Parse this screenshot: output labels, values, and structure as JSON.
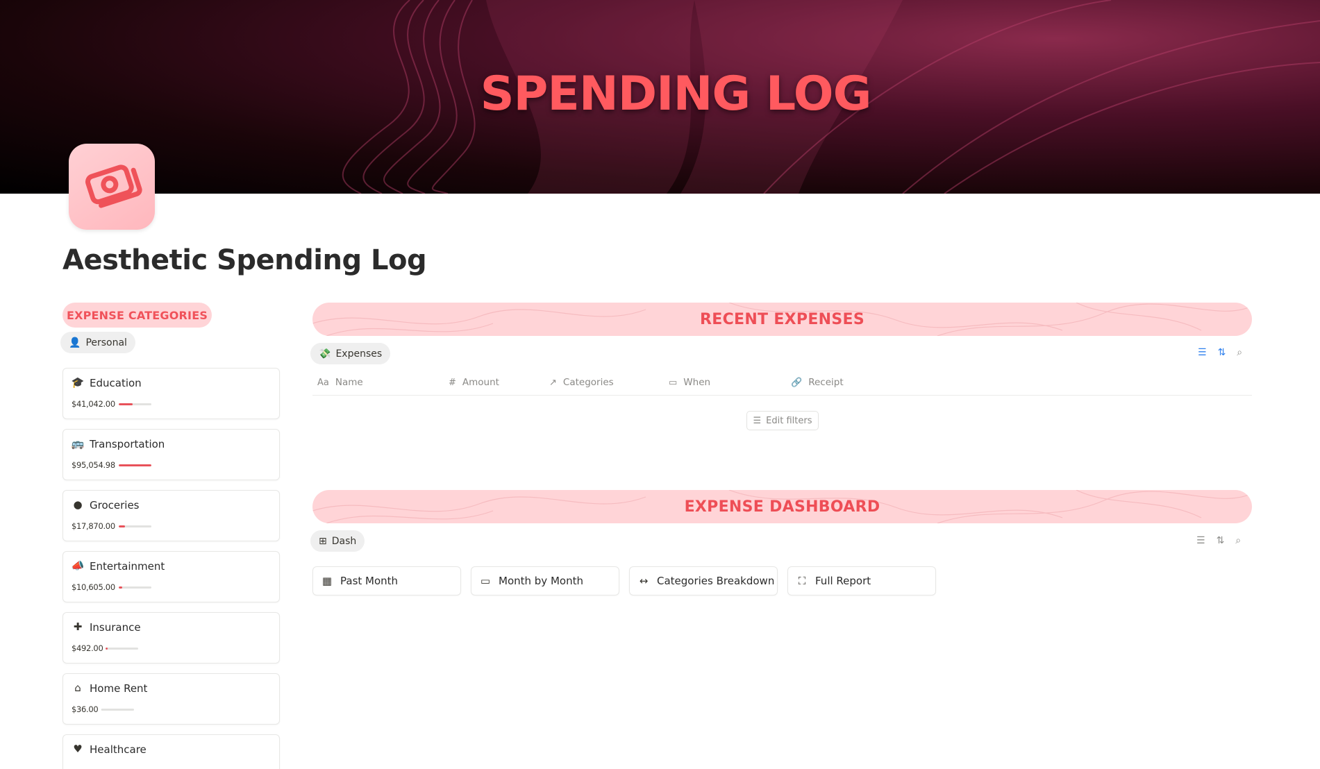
{
  "banner": {
    "title": "SPENDING LOG"
  },
  "page": {
    "title": "Aesthetic Spending Log"
  },
  "categories": {
    "header": "EXPENSE CATEGORIES",
    "view_label": "Personal",
    "items": [
      {
        "name": "Education",
        "amount": "$41,042.00",
        "icon": "graduation-cap-icon",
        "glyph": "🎓",
        "progress": 0.43
      },
      {
        "name": "Transportation",
        "amount": "$95,054.98",
        "icon": "bus-icon",
        "glyph": "🚌",
        "progress": 1.0
      },
      {
        "name": "Groceries",
        "amount": "$17,870.00",
        "icon": "apple-icon",
        "glyph": "●",
        "progress": 0.19
      },
      {
        "name": "Entertainment",
        "amount": "$10,605.00",
        "icon": "megaphone-icon",
        "glyph": "📣",
        "progress": 0.11
      },
      {
        "name": "Insurance",
        "amount": "$492.00",
        "icon": "plus-icon",
        "glyph": "✚",
        "progress": 0.01
      },
      {
        "name": "Home Rent",
        "amount": "$36.00",
        "icon": "house-icon",
        "glyph": "⌂",
        "progress": 0.0
      },
      {
        "name": "Healthcare",
        "amount": "",
        "icon": "heart-pulse-icon",
        "glyph": "♥",
        "progress": 0.0
      }
    ]
  },
  "recent": {
    "header": "RECENT EXPENSES",
    "view_label": "Expenses",
    "columns": [
      {
        "label": "Name",
        "icon": "Aa"
      },
      {
        "label": "Amount",
        "icon": "#"
      },
      {
        "label": "Categories",
        "icon": "↗"
      },
      {
        "label": "When",
        "icon": "▭"
      },
      {
        "label": "Receipt",
        "icon": "🔗"
      }
    ],
    "edit_filters_label": "Edit filters"
  },
  "dashboard": {
    "header": "EXPENSE DASHBOARD",
    "view_label": "Dash",
    "buttons": [
      {
        "label": "Past Month",
        "icon": "calendar-grid-icon",
        "glyph": "▦"
      },
      {
        "label": "Month by Month",
        "icon": "calendar-icon",
        "glyph": "▭"
      },
      {
        "label": "Categories Breakdown",
        "icon": "arrows-horizontal-icon",
        "glyph": "↔"
      },
      {
        "label": "Full Report",
        "icon": "expand-icon",
        "glyph": "⛶"
      }
    ]
  },
  "colors": {
    "accent": "#f0525a",
    "pill_bg": "#ffd4d7",
    "bar_fill": "#e8525a"
  }
}
